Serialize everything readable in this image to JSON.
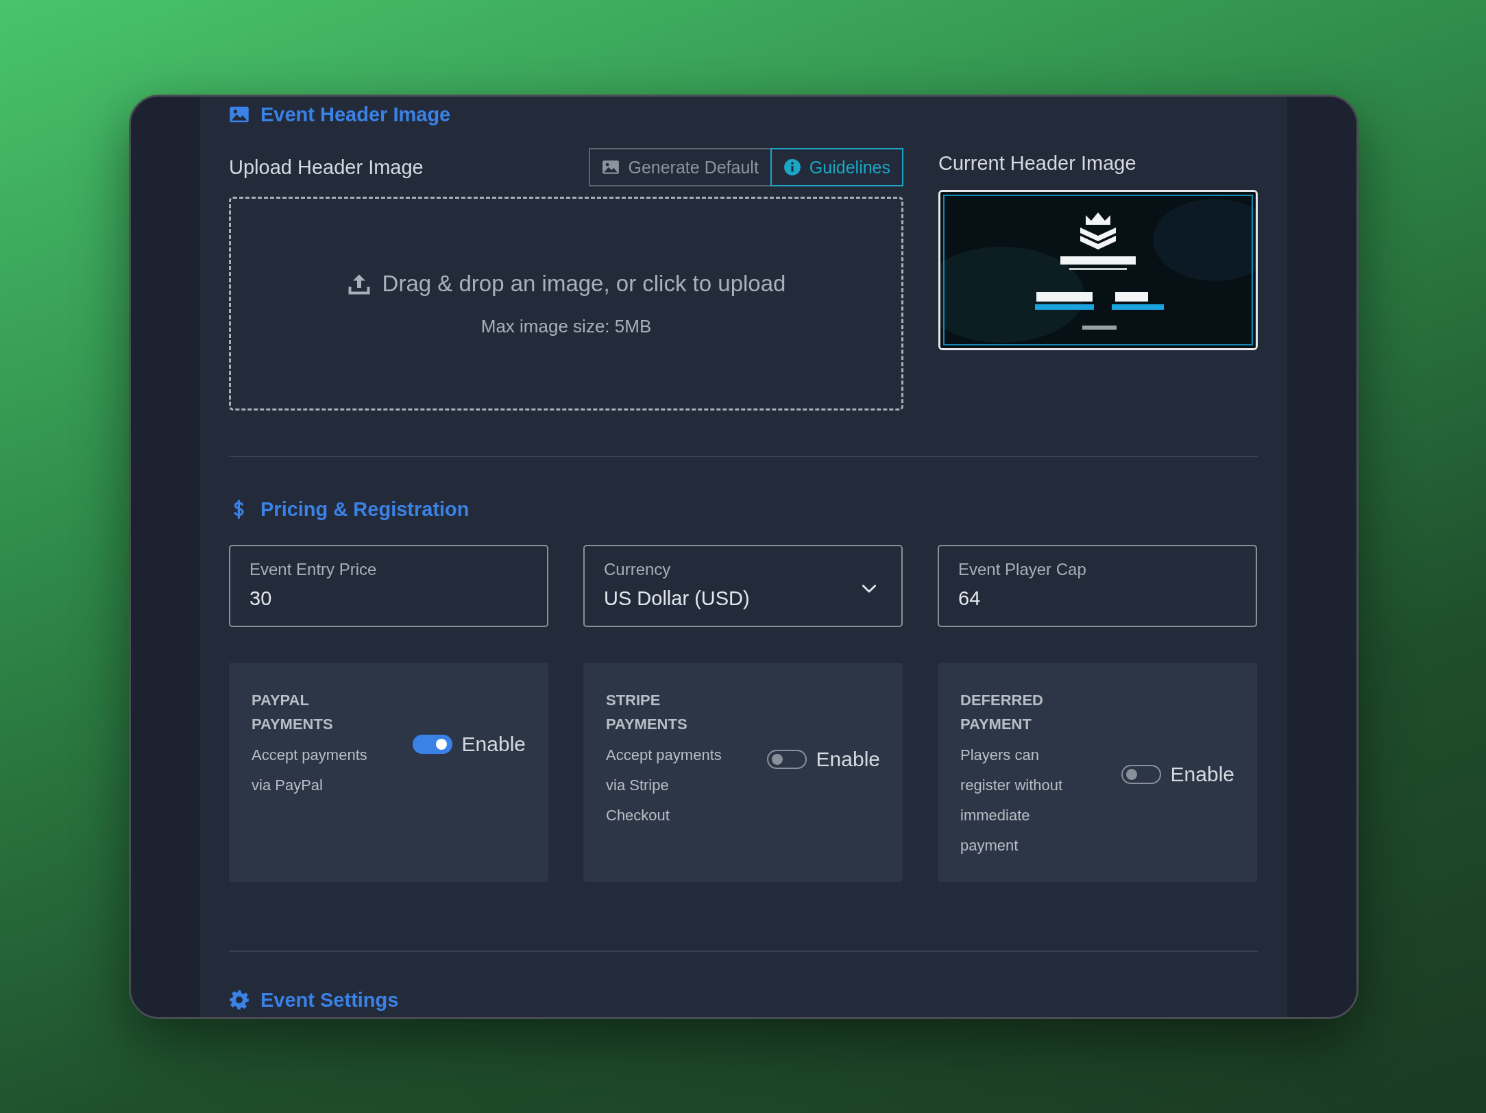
{
  "header_image": {
    "title": "Event Header Image",
    "upload_label": "Upload Header Image",
    "buttons": [
      {
        "label": "Generate Default",
        "kind": "generate",
        "selected": false
      },
      {
        "label": "Guidelines",
        "kind": "info",
        "selected": true
      }
    ],
    "dropzone": {
      "text": "Drag & drop an image, or click to upload",
      "hint": "Max image size: 5MB"
    },
    "current": {
      "label": "Current Header Image"
    }
  },
  "pricing": {
    "title": "Pricing & Registration",
    "fields": [
      {
        "label": "Event Entry Price",
        "value": "30",
        "kind": "text"
      },
      {
        "label": "Currency",
        "value": "US Dollar (USD)",
        "kind": "select"
      },
      {
        "label": "Event Player Cap",
        "value": "64",
        "kind": "text"
      }
    ],
    "payments": [
      {
        "title": "PAYPAL PAYMENTS",
        "description": "Accept payments via PayPal",
        "toggle_label": "Enable",
        "on": true
      },
      {
        "title": "STRIPE PAYMENTS",
        "description": "Accept payments via Stripe Checkout",
        "toggle_label": "Enable",
        "on": false
      },
      {
        "title": "DEFERRED PAYMENT",
        "description": "Players can register without immediate payment",
        "toggle_label": "Enable",
        "on": false
      }
    ]
  },
  "settings": {
    "title": "Event Settings"
  }
}
